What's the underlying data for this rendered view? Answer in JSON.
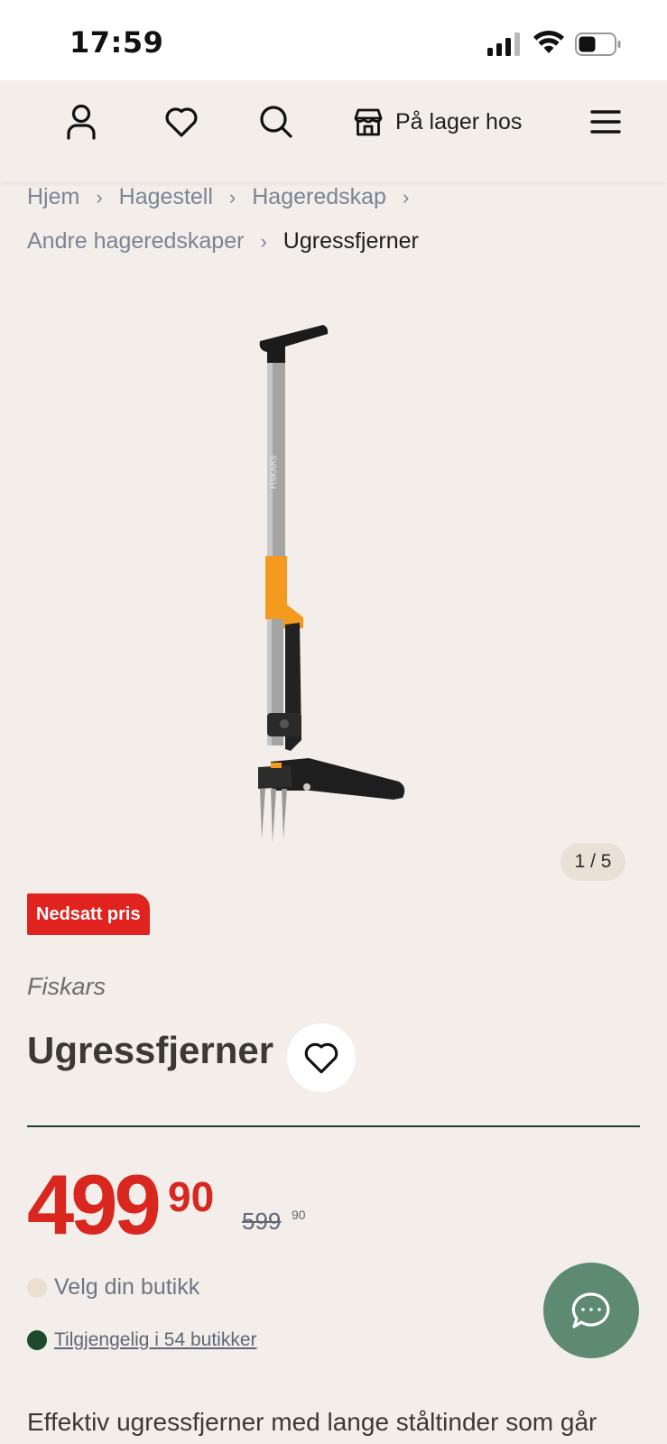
{
  "status_bar": {
    "time": "17:59"
  },
  "nav": {
    "store_label": "På lager hos",
    "icons": [
      "account-icon",
      "heart-icon",
      "search-icon",
      "store-icon",
      "menu-icon"
    ]
  },
  "breadcrumb": {
    "items": [
      "Hjem",
      "Hagestell",
      "Hageredskap",
      "Andre hageredskaper"
    ],
    "current": "Ugressfjerner"
  },
  "gallery": {
    "counter": "1 / 5",
    "current_index": 1,
    "total": 5
  },
  "product": {
    "badge": "Nedsatt pris",
    "brand": "Fiskars",
    "title": "Ugressfjerner",
    "price_main": "499",
    "price_decimals": "90",
    "old_price_main": "599",
    "old_price_decimals": "90",
    "store_select": "Velg din butikk",
    "availability": "Tilgjengelig i 54 butikker",
    "description": "Effektiv ugressfjerner med lange ståltinder som går"
  },
  "colors": {
    "background": "#f3eeea",
    "sale_red": "#d9261f",
    "chat_green": "#5e8a72",
    "available_green": "#1b4b2c"
  }
}
